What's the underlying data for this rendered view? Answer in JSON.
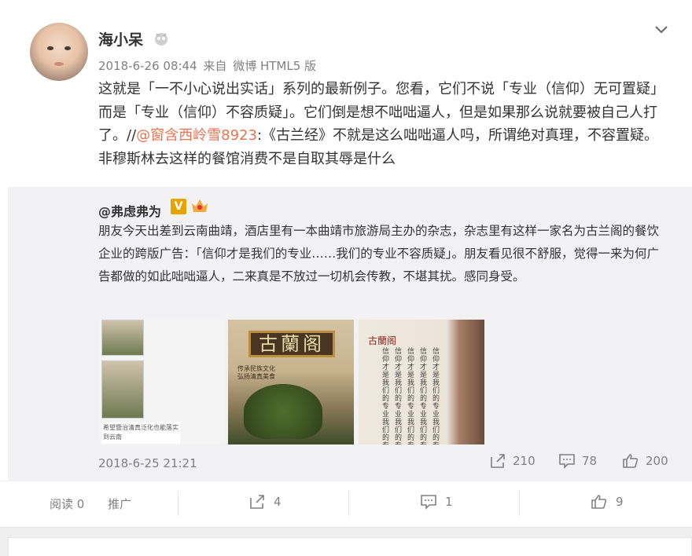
{
  "post": {
    "username": "海小呆",
    "timestamp": "2018-6-26 08:44",
    "source_prefix": "来自",
    "source": "微博 HTML5 版",
    "text_before_mention": "这就是「一不小心说出实话」系列的最新例子。您看，它们不说「专业（信仰）无可置疑」而是「专业（信仰）不容质疑」。它们倒是想不咄咄逼人，但是如果那么说就要被自己人打了。//",
    "mention": "@窗含西岭雪8923",
    "text_after_mention": ":《古兰经》不就是这么咄咄逼人吗，所谓绝对真理，不容置疑。非穆斯林去这样的餐馆消费不是自取其辱是什么"
  },
  "repost": {
    "username": "@弗虑弗为",
    "v_badge": "V",
    "text": "朋友今天出差到云南曲靖，酒店里有一本曲靖市旅游局主办的杂志，杂志里有这样一家名为古兰阁的餐饮企业的跨版广告：「信仰才是我们的专业……我们的专业不容质疑」。朋友看见很不舒服，觉得一来为何广告都做的如此咄咄逼人，二来真是不放过一切机会传教，不堪其扰。感同身受。",
    "images": {
      "img1_caption": "希望暨治清真泛化也能落实到云南",
      "img2_sign": "古蘭阁",
      "img2_lines": [
        "传承民族文化",
        "弘扬清真美食"
      ],
      "img3_logo": "古蘭阁",
      "img3_text": "信仰才是我们的专业我们的专业不容质疑"
    },
    "date": "2018-6-25 21:21",
    "shares": "210",
    "comments": "78",
    "likes": "200"
  },
  "footer": {
    "read_label": "阅读 0",
    "promote_label": "推广",
    "shares": "4",
    "comments": "1",
    "likes": "9"
  },
  "icons": [
    "menu-chevron-down-icon",
    "user-badge-icon",
    "share-icon",
    "comment-icon",
    "like-icon",
    "crown-icon"
  ],
  "colors": {
    "mention": "#eb7350",
    "repost_bg": "#f2f2f5",
    "v_badge": "#e8a400",
    "meta": "#808080"
  }
}
